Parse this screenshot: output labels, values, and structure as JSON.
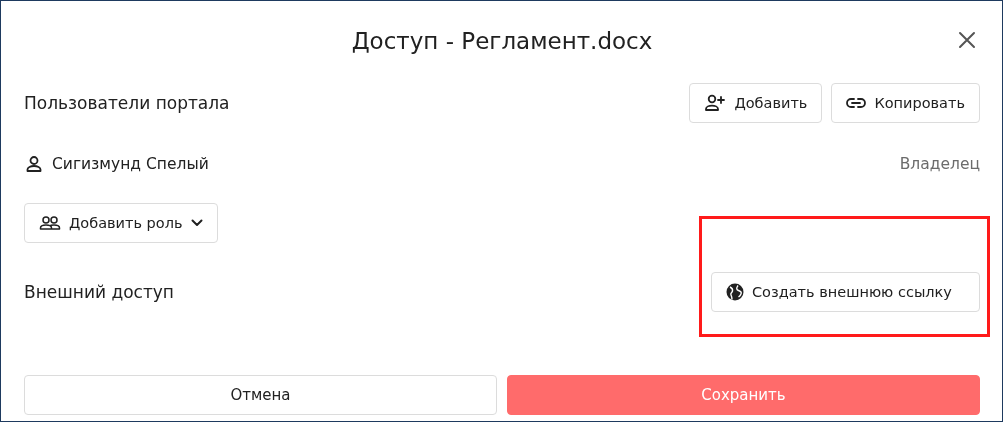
{
  "dialog": {
    "title": "Доступ - Регламент.docx"
  },
  "portal_users": {
    "heading": "Пользователи портала",
    "buttons": [
      {
        "kind": "add",
        "label": "Добавить"
      },
      {
        "kind": "copy",
        "label": "Копировать"
      }
    ]
  },
  "users": [
    {
      "name": "Сигизмунд Спелый",
      "role": "Владелец"
    }
  ],
  "add_role": {
    "label": "Добавить роль"
  },
  "external_access": {
    "heading": "Внешний доступ",
    "button": {
      "label": "Создать внешнюю ссылку",
      "highlighted": true
    }
  },
  "footer": {
    "cancel": "Отмена",
    "save": "Сохранить"
  }
}
